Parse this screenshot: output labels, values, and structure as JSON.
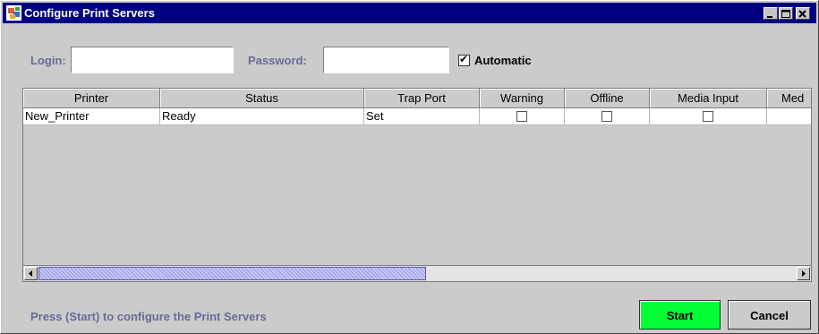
{
  "window": {
    "title": "Configure Print Servers"
  },
  "login": {
    "label": "Login:",
    "value": "",
    "placeholder": ""
  },
  "password": {
    "label": "Password:",
    "value": "",
    "placeholder": ""
  },
  "automatic": {
    "label": "Automatic",
    "checked": true,
    "check_glyph": "✔"
  },
  "table": {
    "columns": [
      "Printer",
      "Status",
      "Trap Port",
      "Warning",
      "Offline",
      "Media Input",
      "Med"
    ],
    "rows": [
      {
        "printer": "New_Printer",
        "status": "Ready",
        "trap_port": "Set",
        "warning": false,
        "offline": false,
        "media_input": false
      }
    ]
  },
  "scrollbar": {
    "thumb_fraction": 0.5,
    "left_icon": "scroll-left-icon",
    "right_icon": "scroll-right-icon"
  },
  "status_message": "Press (Start) to configure the Print Servers",
  "buttons": {
    "start": "Start",
    "cancel": "Cancel"
  },
  "colors": {
    "title_bar": "#000080",
    "start_button": "#00ff33",
    "label_text": "#6a6a99",
    "background": "#cbcbcb"
  }
}
